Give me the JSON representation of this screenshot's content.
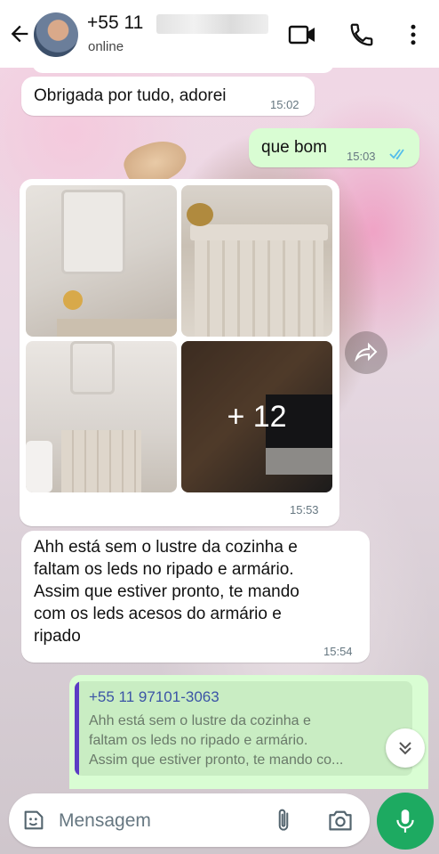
{
  "header": {
    "contact_name": "+55 11",
    "status": "online",
    "icons": [
      "back-arrow-icon",
      "video-call-icon",
      "phone-icon",
      "more-vert-icon"
    ]
  },
  "messages": [
    {
      "direction": "in",
      "text": "Obrigada por tudo, adorei",
      "time": "15:02"
    },
    {
      "direction": "out",
      "text": "que bom",
      "time": "15:03",
      "read": true
    },
    {
      "direction": "in",
      "type": "photo-album",
      "extra_count": "+ 12",
      "time": "15:53"
    },
    {
      "direction": "in",
      "lines": [
        "Ahh está sem o lustre da cozinha e",
        "faltam os leds no ripado e armário.",
        "Assim que estiver pronto, te mando",
        "com os leds acesos do armário e",
        "ripado"
      ],
      "time": "15:54"
    }
  ],
  "reply": {
    "author": "+55 11 97101-3063",
    "lines": [
      "Ahh está sem o lustre da cozinha e",
      "faltam os leds no ripado e armário.",
      "Assim que estiver pronto, te mando co..."
    ]
  },
  "composer": {
    "placeholder": "Mensagem"
  },
  "colors": {
    "outgoing_bubble": "#d9fdd3",
    "incoming_bubble": "#ffffff",
    "accent_green": "#1daa61",
    "read_ticks": "#53bdeb",
    "quote_bar": "#5b3cc4"
  }
}
